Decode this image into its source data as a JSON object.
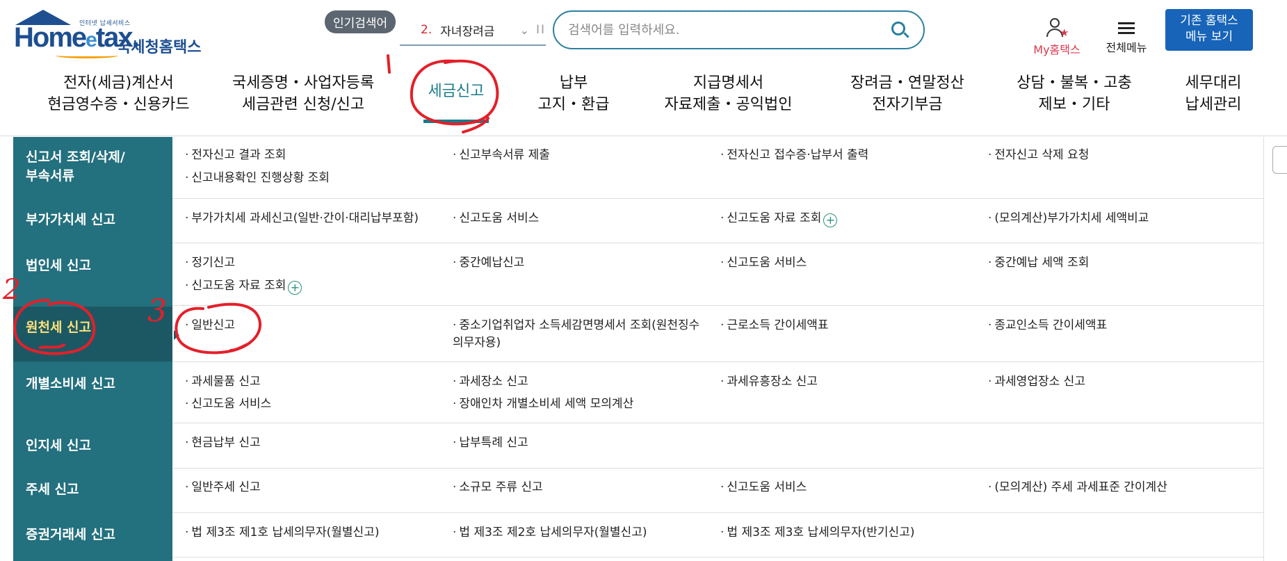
{
  "header": {
    "logo_sub": "인터넷 납세서비스",
    "logo_home": "Home",
    "logo_e": "e",
    "logo_tax": "tax.",
    "logo_kr": "국세청홈택스",
    "popular_badge": "인기검색어",
    "popular_rank": "2.",
    "popular_term": "자녀장려금",
    "search_placeholder": "검색어를 입력하세요.",
    "my_hometax": "My홈택스",
    "all_menu": "전체메뉴",
    "old_menu_line1": "기존 홈택스",
    "old_menu_line2": "메뉴 보기"
  },
  "gnb": [
    {
      "line1": "전자(세금)계산서",
      "line2": "현금영수증・신용카드"
    },
    {
      "line1": "국세증명・사업자등록",
      "line2": "세금관련 신청/신고"
    },
    {
      "line1": "세금신고",
      "line2": ""
    },
    {
      "line1": "납부",
      "line2": "고지・환급"
    },
    {
      "line1": "지급명세서",
      "line2": "자료제출・공익법인"
    },
    {
      "line1": "장려금・연말정산",
      "line2": "전자기부금"
    },
    {
      "line1": "상담・불복・고충",
      "line2": "제보・기타"
    },
    {
      "line1": "세무대리",
      "line2": "납세관리"
    }
  ],
  "categories": [
    {
      "label": "신고서 조회/삭제/\n부속서류"
    },
    {
      "label": "부가가치세 신고"
    },
    {
      "label": "법인세 신고"
    },
    {
      "label": "원천세 신고"
    },
    {
      "label": "개별소비세 신고"
    },
    {
      "label": "인지세 신고"
    },
    {
      "label": "주세 신고"
    },
    {
      "label": "증권거래세 신고"
    }
  ],
  "links": {
    "r0": [
      "전자신고 결과 조회",
      "신고부속서류 제출",
      "전자신고 접수증·납부서 출력",
      "전자신고 삭제 요청",
      "신고내용확인 진행상황 조회"
    ],
    "r1": [
      "부가가치세 과세신고(일반·간이·대리납부포함)",
      "신고도움 서비스",
      "신고도움 자료 조회",
      "(모의계산)부가가치세 세액비교"
    ],
    "r2": [
      "정기신고",
      "중간예납신고",
      "신고도움 서비스",
      "중간예납 세액 조회",
      "신고도움 자료 조회"
    ],
    "r3": [
      "일반신고",
      "중소기업취업자 소득세감면명세서 조회(원천징수의무자용)",
      "근로소득 간이세액표",
      "종교인소득 간이세액표"
    ],
    "r4": [
      "과세물품 신고",
      "과세장소 신고",
      "과세유흥장소 신고",
      "과세영업장소 신고",
      "신고도움 서비스",
      "장애인차 개별소비세 세액 모의계산"
    ],
    "r5": [
      "현금납부 신고",
      "납부특례 신고"
    ],
    "r6": [
      "일반주세 신고",
      "소규모 주류 신고",
      "신고도움 서비스",
      "(모의계산) 주세 과세표준 간이계산"
    ],
    "r7": [
      "법 제3조 제1호 납세의무자(월별신고)",
      "법 제3조 제2호 납세의무자(월별신고)",
      "법 제3조 제3호 납세의무자(반기신고)"
    ]
  },
  "plus_symbol": "+",
  "annotations": {
    "mark1": "1",
    "mark2": "2",
    "mark3": "3"
  },
  "colors": {
    "brand": "#1d4f91",
    "teal": "#23707e",
    "active": "#1b7a8b",
    "annotation": "#e3202a",
    "selected_label": "#ffe27a"
  }
}
